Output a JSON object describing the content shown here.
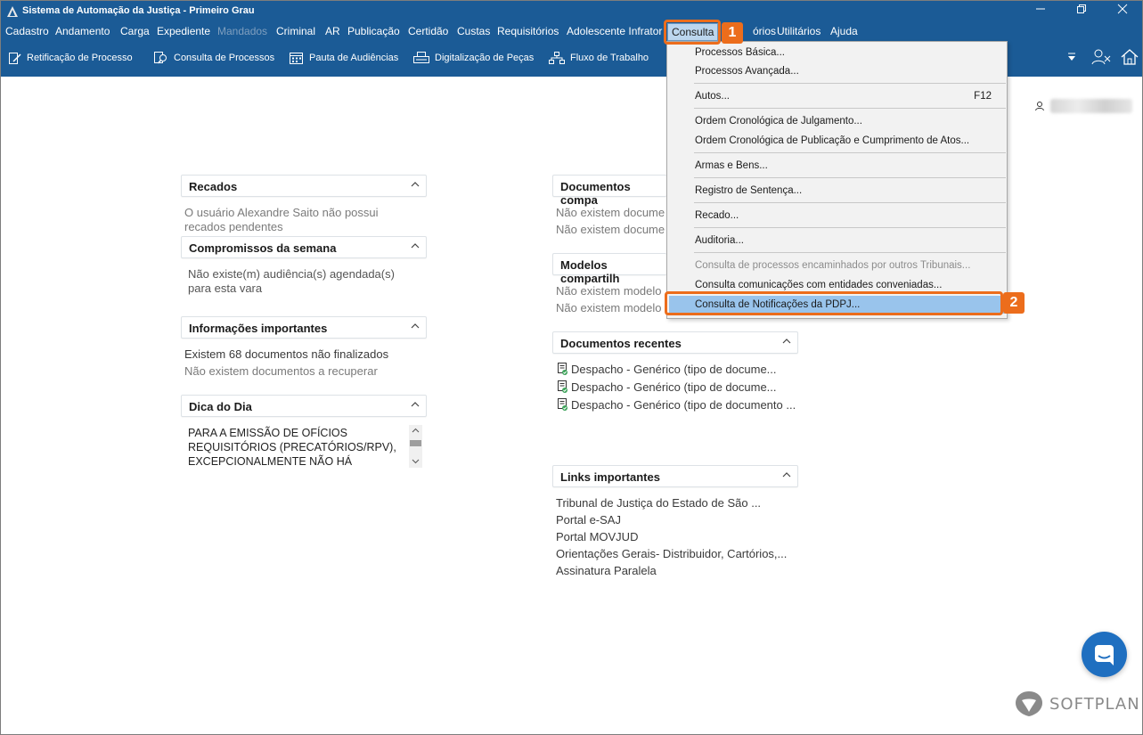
{
  "window": {
    "title": "Sistema de Automação da Justiça - Primeiro Grau",
    "minimize_icon": "minimize-icon",
    "restore_icon": "restore-icon",
    "close_icon": "close-icon"
  },
  "colors": {
    "chrome": "#1b5b96",
    "callout": "#ec6d1c",
    "menu_highlight": "#99c4ec",
    "menu_bg": "#f2f2f2"
  },
  "menubar": {
    "items": [
      "Cadastro",
      "Andamento",
      "Carga",
      "Expediente",
      "Mandados",
      "Criminal",
      "AR",
      "Publicação",
      "Certidão",
      "Custas",
      "Requisitórios",
      "Adolescente Infrator",
      "Consulta",
      "Relatórios",
      "Utilitários",
      "Ajuda"
    ],
    "visible_relatorios": "órios",
    "disabled": "Mandados",
    "active": "Consulta"
  },
  "toolbar": {
    "items": [
      "Retificação de Processo",
      "Consulta de Processos",
      "Pauta de Audiências",
      "Digitalização de Peças",
      "Fluxo de Trabalho"
    ],
    "right_icons": [
      "dropdown-arrow-icon",
      "users-icon",
      "home-icon"
    ]
  },
  "user": {
    "icon": "user-icon",
    "name": ""
  },
  "panels": {
    "recados": {
      "title": "Recados",
      "lines": [
        "O usuário Alexandre Saito não possui",
        "recados pendentes"
      ]
    },
    "compromissos": {
      "title": "Compromissos da semana",
      "lines": [
        "Não existe(m) audiência(s) agendada(s)",
        "para esta vara"
      ]
    },
    "informacoes": {
      "title": "Informações importantes",
      "lines": [
        "Existem 68 documentos não finalizados",
        "Não existem documentos a recuperar"
      ]
    },
    "dica": {
      "title": "Dica do Dia",
      "text": "PARA A EMISSÃO DE OFÍCIOS REQUISITÓRIOS (PRECATÓRIOS/RPV), EXCEPCIONALMENTE NÃO HÁ"
    },
    "docs_compartilhados": {
      "title": "Documentos compa",
      "lines": [
        "Não existem docume",
        "Não existem docume"
      ]
    },
    "modelos": {
      "title": "Modelos compartilh",
      "lines": [
        "Não existem modelo",
        "Não existem modelo"
      ]
    },
    "recentes": {
      "title": "Documentos recentes",
      "items": [
        "Despacho - Genérico (tipo de docume...",
        "Despacho - Genérico (tipo de docume...",
        "Despacho - Genérico (tipo de documento ..."
      ]
    },
    "links": {
      "title": "Links importantes",
      "items": [
        "Tribunal de Justiça do Estado de São ...",
        "Portal e-SAJ",
        "Portal MOVJUD",
        "Orientações Gerais- Distribuidor, Cartórios,...",
        "Assinatura Paralela"
      ]
    }
  },
  "consulta_menu": {
    "items": [
      {
        "label": "Processos Básica...",
        "shortcut": ""
      },
      {
        "label": "Processos Avançada...",
        "shortcut": ""
      },
      {
        "label": "Autos...",
        "shortcut": "F12"
      },
      {
        "label": "Ordem Cronológica de Julgamento...",
        "shortcut": ""
      },
      {
        "label": "Ordem Cronológica de Publicação e Cumprimento de Atos...",
        "shortcut": ""
      },
      {
        "label": "Armas e Bens...",
        "shortcut": ""
      },
      {
        "label": "Registro de Sentença...",
        "shortcut": ""
      },
      {
        "label": "Recado...",
        "shortcut": ""
      },
      {
        "label": "Auditoria...",
        "shortcut": ""
      },
      {
        "label": "Consulta de processos encaminhados por outros Tribunais...",
        "shortcut": "",
        "disabled": true
      },
      {
        "label": "Consulta comunicações com entidades conveniadas...",
        "shortcut": ""
      },
      {
        "label": "Consulta de Notificações da PDPJ...",
        "shortcut": "",
        "highlighted": true
      }
    ]
  },
  "callouts": [
    "1",
    "2"
  ],
  "brand": {
    "name": "SOFTPLAN",
    "icon": "softplan-logo-icon"
  },
  "chat": {
    "icon": "chat-icon"
  }
}
